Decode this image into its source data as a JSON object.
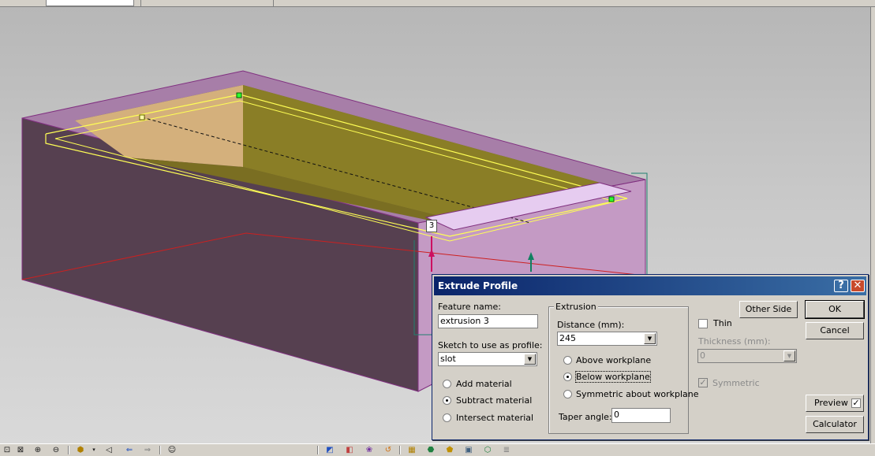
{
  "dialog": {
    "title": "Extrude Profile",
    "feature_name_label": "Feature name:",
    "feature_name_value": "extrusion 3",
    "sketch_label": "Sketch to use as profile:",
    "sketch_value": "slot",
    "material_options": [
      {
        "label": "Add material",
        "selected": false
      },
      {
        "label": "Subtract material",
        "selected": true
      },
      {
        "label": "Intersect material",
        "selected": false
      }
    ],
    "extrusion": {
      "group_label": "Extrusion",
      "distance_label": "Distance (mm):",
      "distance_value": "245",
      "options": [
        {
          "label": "Above workplane",
          "selected": false
        },
        {
          "label": "Below workplane",
          "selected": true
        },
        {
          "label": "Symmetric about workplane",
          "selected": false
        }
      ],
      "taper_label": "Taper angle:",
      "taper_value": "0"
    },
    "other_side_label": "Other Side",
    "thin_label": "Thin",
    "thin_checked": false,
    "thickness_label": "Thickness (mm):",
    "thickness_value": "0",
    "symmetric_label": "Symmetric",
    "symmetric_checked": true,
    "ok_label": "OK",
    "cancel_label": "Cancel",
    "preview_label": "Preview",
    "preview_checked": true,
    "calculator_label": "Calculator"
  },
  "viewport": {
    "sketch_tag": "3"
  },
  "colors": {
    "titlebar_start": "#0a246a",
    "titlebar_end": "#3a6ea5",
    "box_side": "#5a4452",
    "box_top": "#a67ea8",
    "box_end_face": "#c69ec6",
    "floor": "#8a8024",
    "sketch_line": "#ffff66"
  },
  "toolbar_icons": [
    "zoom-fit-icon",
    "zoom-window-icon",
    "zoom-in-icon",
    "zoom-out-icon",
    "view-cube-icon",
    "view-direction-icon",
    "previous-view-icon",
    "next-view-icon",
    "smiley-icon",
    "extrude-icon",
    "box-icon",
    "revolve-icon",
    "sweep-icon",
    "workplane-icon",
    "solid-a-icon",
    "solid-b-icon",
    "solid-c-icon",
    "solid-d-icon",
    "scroll-icon"
  ]
}
